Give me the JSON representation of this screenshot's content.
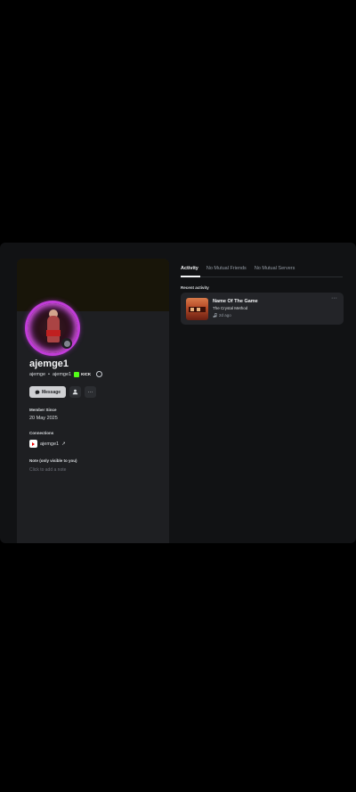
{
  "profile": {
    "display_name": "ajemge1",
    "username": "ajemge",
    "separator": "•",
    "secondary_name": "ajemge1",
    "badge_label": "KICK",
    "message_button": "Message",
    "member_since_title": "Member Since",
    "member_since_value": "20 May 2025",
    "connections_title": "Connections",
    "connection_name": "ajemge1",
    "connection_arrow": "↗",
    "note_title": "Note (only visible to you)",
    "note_placeholder": "Click to add a note"
  },
  "tabs": [
    {
      "label": "Activity",
      "active": true
    },
    {
      "label": "No Mutual Friends",
      "active": false
    },
    {
      "label": "No Mutual Servers",
      "active": false
    }
  ],
  "activity": {
    "section_title": "Recent activity",
    "song_title": "Name Of The Game",
    "artist": "The Crystal Method",
    "time": "2d ago",
    "more": "···"
  },
  "colors": {
    "avatar_ring": "#c13cd8",
    "status": "#80848e",
    "kick_green": "#53fc18"
  }
}
